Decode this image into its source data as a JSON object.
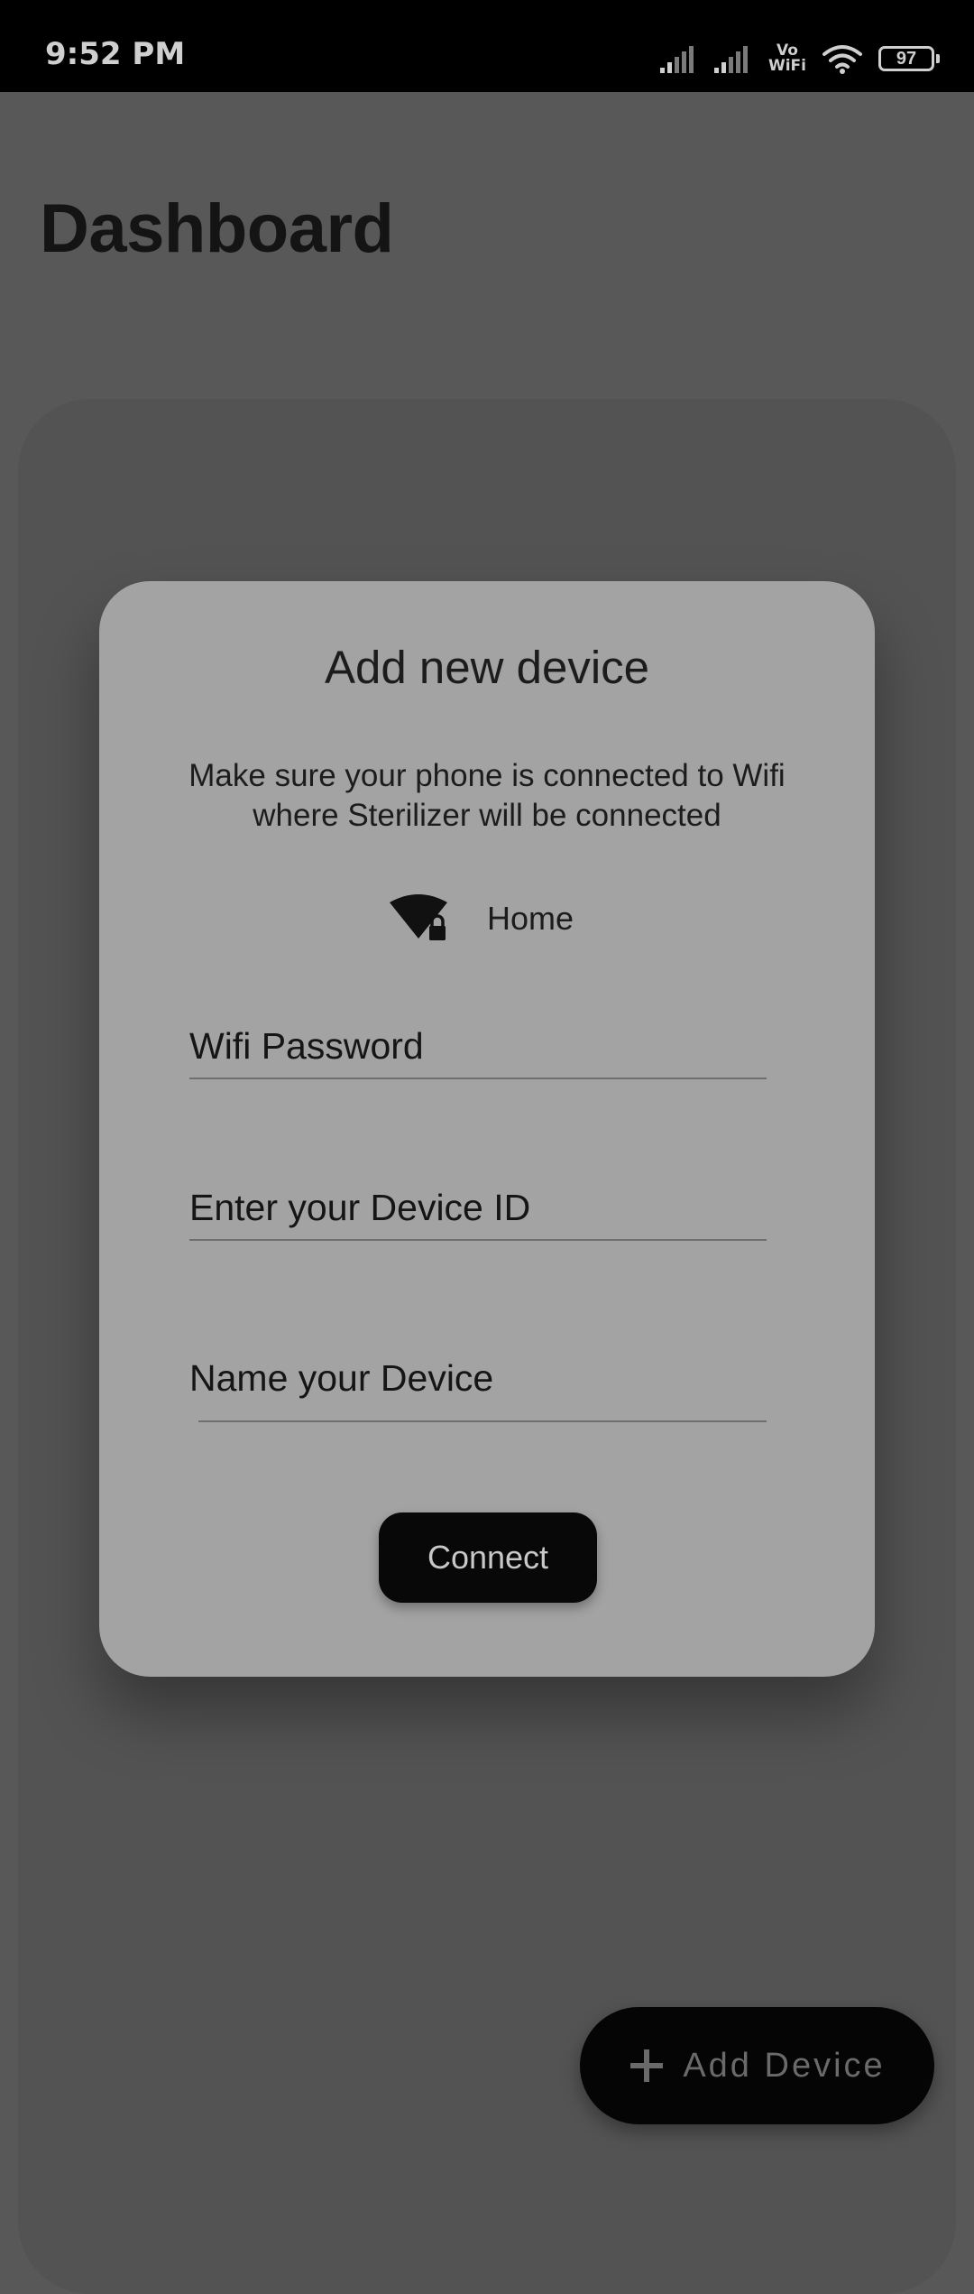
{
  "status_bar": {
    "time": "9:52 PM",
    "volte_line1": "Vo",
    "volte_line2": "WiFi",
    "battery_level": "97",
    "icons": [
      "signal-icon",
      "signal-icon",
      "volte-wifi-icon",
      "wifi-icon",
      "battery-icon"
    ]
  },
  "page": {
    "title": "Dashboard"
  },
  "dialog": {
    "title": "Add new device",
    "message": "Make sure your phone is connected to Wifi where Sterilizer will be connected",
    "network_icon": "wifi-lock-icon",
    "network_name": "Home",
    "wifi_password_placeholder": "Wifi Password",
    "device_id_placeholder": "Enter your Device ID",
    "device_name_label": "Name your Device",
    "connect_label": "Connect"
  },
  "fab": {
    "icon": "plus-icon",
    "label": "Add Device"
  },
  "colors": {
    "scrim_background": "#585858",
    "dialog_background": "#a3a3a3",
    "button_background": "#080808",
    "status_bar_background": "#000000"
  }
}
